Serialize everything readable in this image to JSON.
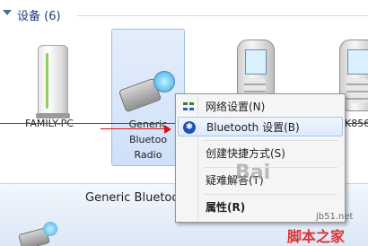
{
  "group": {
    "title": "设备 (6)"
  },
  "devices": [
    {
      "name": "FAMILY-PC"
    },
    {
      "name_lines": [
        "Generic",
        "Bluetoo",
        "Radio"
      ]
    },
    {
      "name": ""
    },
    {
      "name": "K856"
    }
  ],
  "context_menu": {
    "items": [
      {
        "label": "网络设置(N)",
        "icon": "network-icon"
      },
      {
        "label": "Bluetooth 设置(B)",
        "icon": "bluetooth-icon"
      },
      {
        "label": "创建快捷方式(S)"
      },
      {
        "label": "疑难解答(T)"
      },
      {
        "label": "属性(R)"
      }
    ]
  },
  "details_pane": {
    "title": "Generic Bluetoot"
  },
  "watermarks": {
    "baidu": "Bai",
    "site": "jb51.net",
    "brand": "脚本之家"
  },
  "colors": {
    "selection": "#cfe0f8",
    "annotation_red": "#d11",
    "menu_highlight": "#dceafb"
  }
}
